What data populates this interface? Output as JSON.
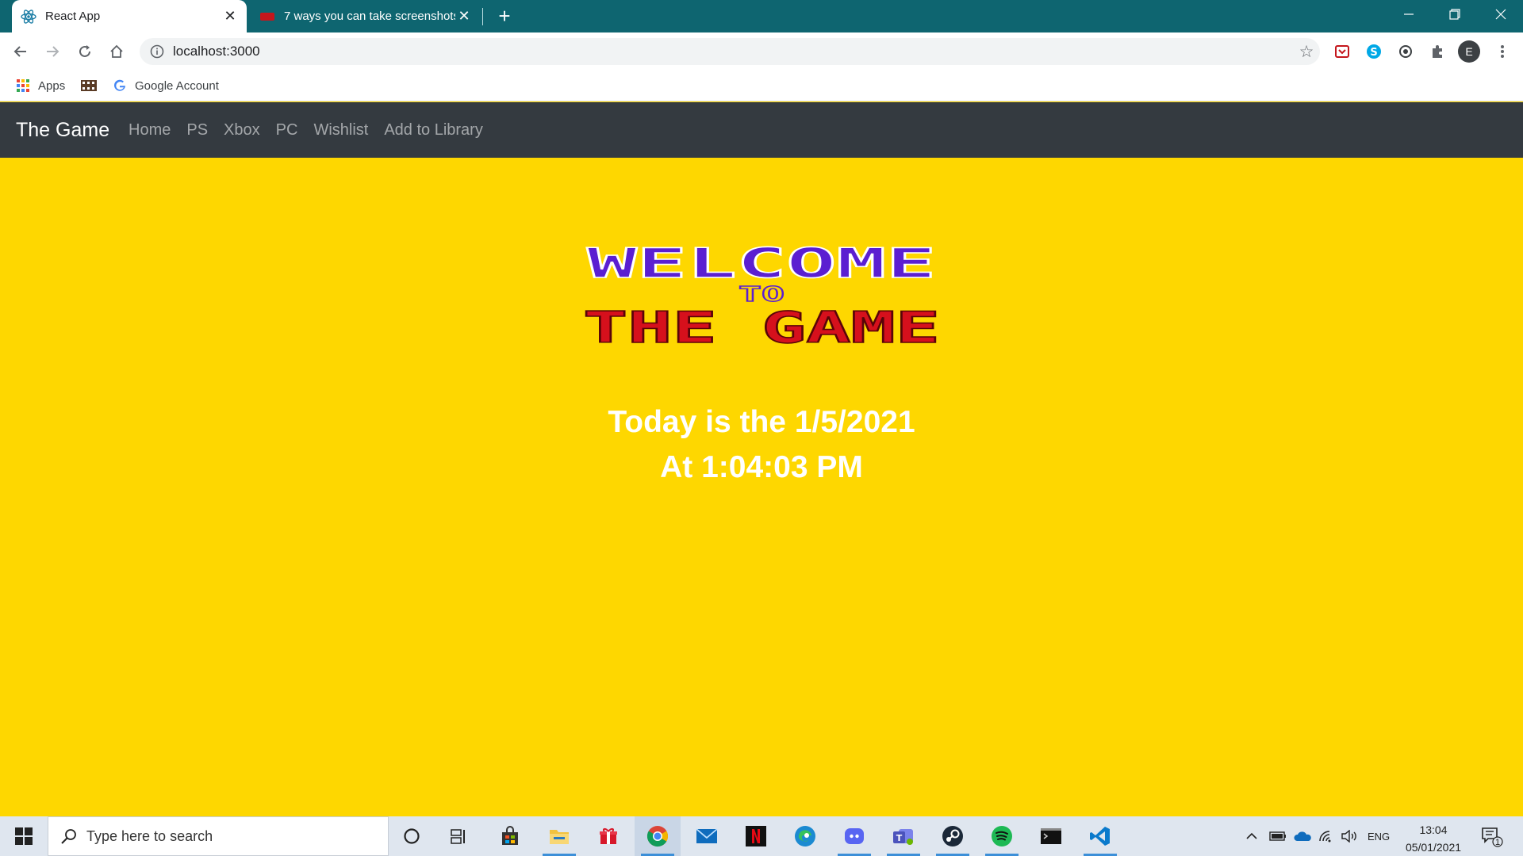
{
  "browser": {
    "tabs": [
      {
        "title": "React App",
        "active": true
      },
      {
        "title": "7 ways you can take screenshots",
        "active": false
      }
    ],
    "url": "localhost:3000",
    "bookmarks": [
      {
        "label": "Apps"
      },
      {
        "label": ""
      },
      {
        "label": "Google Account"
      }
    ],
    "profile_initial": "E"
  },
  "navbar": {
    "brand": "The Game",
    "links": [
      "Home",
      "PS",
      "Xbox",
      "PC",
      "Wishlist",
      "Add to Library"
    ]
  },
  "logo": {
    "line1": "WELCOME",
    "line2": "TO",
    "line3": "THE GAME"
  },
  "main": {
    "date_text": "Today is the 1/5/2021",
    "time_text": "At 1:04:03 PM"
  },
  "taskbar": {
    "search_placeholder": "Type here to search",
    "language": "ENG",
    "time": "13:04",
    "date": "05/01/2021",
    "notification_count": "1"
  },
  "colors": {
    "page_bg": "#fed700",
    "navbar_bg": "#343a40",
    "tab_strip": "#0e6570",
    "welcome_purple": "#5b1fd1",
    "game_red": "#d6101c"
  }
}
